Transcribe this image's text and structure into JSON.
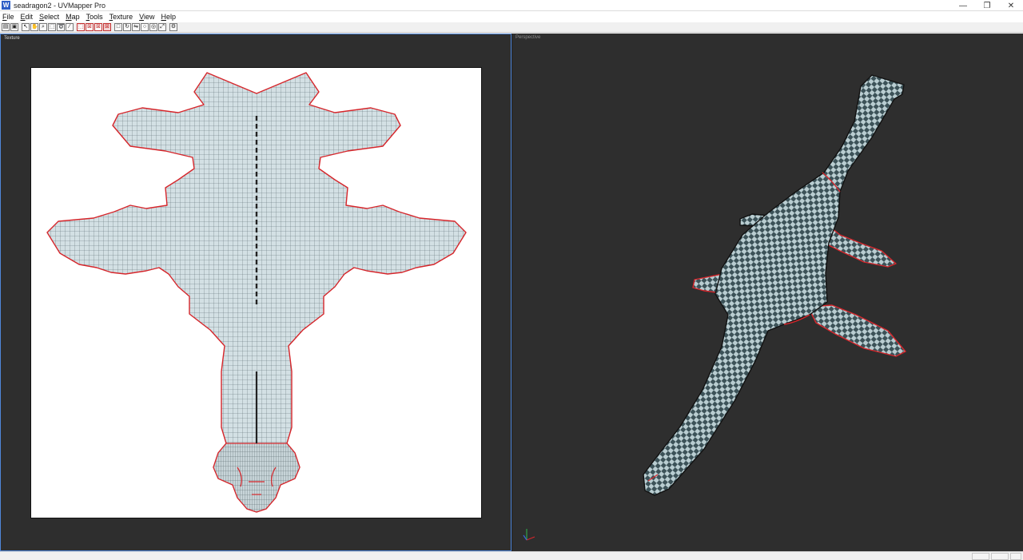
{
  "window": {
    "title": "seadragon2 - UVMapper Pro",
    "icon": "app-icon",
    "icon_letter": "W",
    "minimize_glyph": "—",
    "maximize_glyph": "❐",
    "close_glyph": "✕"
  },
  "menu": [
    {
      "hot": "F",
      "rest": "ile"
    },
    {
      "hot": "E",
      "rest": "dit"
    },
    {
      "hot": "S",
      "rest": "elect"
    },
    {
      "hot": "M",
      "rest": "ap"
    },
    {
      "hot": "T",
      "rest": "ools"
    },
    {
      "hot": "T",
      "rest": "exture"
    },
    {
      "hot": "V",
      "rest": "iew"
    },
    {
      "hot": "H",
      "rest": "elp"
    }
  ],
  "toolbar": {
    "buttons": [
      {
        "name": "open-icon",
        "glyph": "▤"
      },
      {
        "name": "save-icon",
        "glyph": "▣"
      },
      {
        "name": "arrow-select-icon",
        "glyph": "↖"
      },
      {
        "name": "hand-pan-icon",
        "glyph": "✋"
      },
      {
        "name": "zoom-icon",
        "glyph": "⌕"
      },
      {
        "name": "box-select-icon",
        "glyph": "⬚"
      },
      {
        "name": "lasso-select-icon",
        "glyph": "➰"
      },
      {
        "name": "magic-wand-icon",
        "glyph": "⁄"
      },
      {
        "name": "select-rect-red-icon",
        "glyph": "⬚",
        "style": "red"
      },
      {
        "name": "select-vertex-red-icon",
        "glyph": "⊠",
        "style": "red"
      },
      {
        "name": "select-face-red-icon",
        "glyph": "⊠",
        "style": "red"
      },
      {
        "name": "select-group-red-icon",
        "glyph": "⊠",
        "style": "redfill"
      },
      {
        "name": "square-icon",
        "glyph": "□"
      },
      {
        "name": "rotate-icon",
        "glyph": "↻"
      },
      {
        "name": "flip-icon",
        "glyph": "⇋"
      },
      {
        "name": "circle-icon",
        "glyph": "○"
      },
      {
        "name": "target-icon",
        "glyph": "◎"
      },
      {
        "name": "scale-icon",
        "glyph": "⤢"
      },
      {
        "name": "settings-icon",
        "glyph": "⚙"
      }
    ]
  },
  "views": {
    "texture_label": "Texture",
    "perspective_label": "Perspective"
  },
  "colors": {
    "workspace_bg": "#2e2e2e",
    "mesh_fill": "#cfdde2",
    "mesh_line": "#55636a",
    "seam": "#d6262b",
    "checker_dark": "#3c5258",
    "checker_light": "#b9cdd1",
    "active_border": "#4f87d9"
  }
}
